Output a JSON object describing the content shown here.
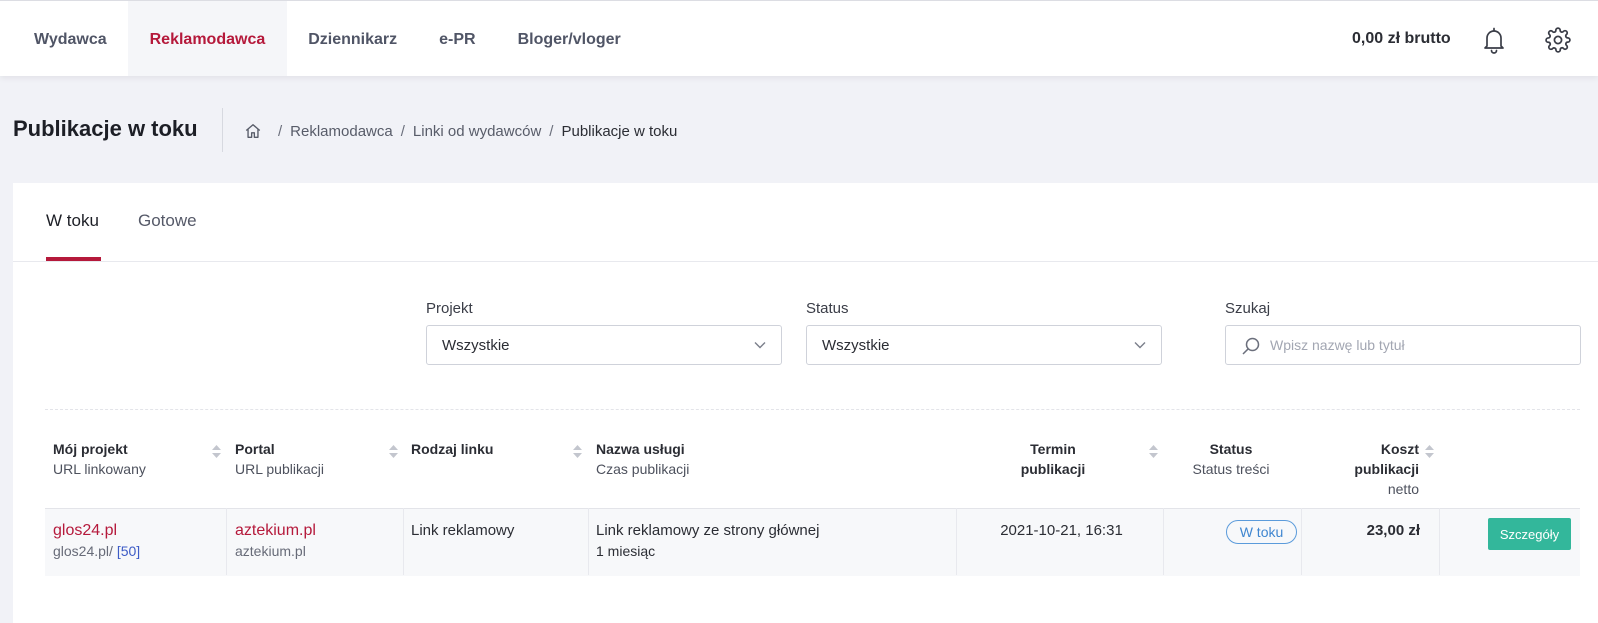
{
  "nav": {
    "items": [
      {
        "label": "Wydawca",
        "active": false
      },
      {
        "label": "Reklamodawca",
        "active": true
      },
      {
        "label": "Dziennikarz",
        "active": false
      },
      {
        "label": "e-PR",
        "active": false
      },
      {
        "label": "Bloger/vloger",
        "active": false
      }
    ],
    "balance": "0,00 zł brutto",
    "icons": [
      "bell-icon",
      "gear-icon"
    ]
  },
  "page": {
    "title": "Publikacje w toku",
    "breadcrumb": [
      "Reklamodawca",
      "Linki od wydawców",
      "Publikacje w toku"
    ],
    "breadcrumb_separator": "/"
  },
  "tabs": [
    {
      "label": "W toku",
      "active": true
    },
    {
      "label": "Gotowe",
      "active": false
    }
  ],
  "filters": {
    "project": {
      "label": "Projekt",
      "value": "Wszystkie"
    },
    "status": {
      "label": "Status",
      "value": "Wszystkie"
    },
    "search": {
      "label": "Szukaj",
      "placeholder": "Wpisz nazwę lub tytuł",
      "value": ""
    }
  },
  "table": {
    "headers": {
      "project": {
        "title": "Mój projekt",
        "sub": "URL linkowany"
      },
      "portal": {
        "title": "Portal",
        "sub": "URL publikacji"
      },
      "link_type": {
        "title": "Rodzaj linku"
      },
      "service": {
        "title": "Nazwa usługi",
        "sub": "Czas publikacji"
      },
      "term": {
        "title_line1": "Termin",
        "title_line2": "publikacji"
      },
      "status": {
        "title": "Status",
        "sub": "Status treści"
      },
      "cost": {
        "title_line1": "Koszt",
        "title_line2": "publikacji",
        "sub": "netto"
      }
    },
    "rows": [
      {
        "project": "glos24.pl",
        "project_url": "glos24.pl/",
        "project_count": "[50]",
        "portal": "aztekium.pl",
        "portal_url": "aztekium.pl",
        "link_type": "Link reklamowy",
        "service": "Link reklamowy ze strony głównej",
        "duration": "1 miesiąc",
        "term": "2021-10-21, 16:31",
        "status": "W toku",
        "cost": "23,00 zł",
        "action": "Szczegóły"
      }
    ]
  },
  "colors": {
    "accent": "#b5193b",
    "button": "#33b79b",
    "status": "#3f86d0"
  }
}
